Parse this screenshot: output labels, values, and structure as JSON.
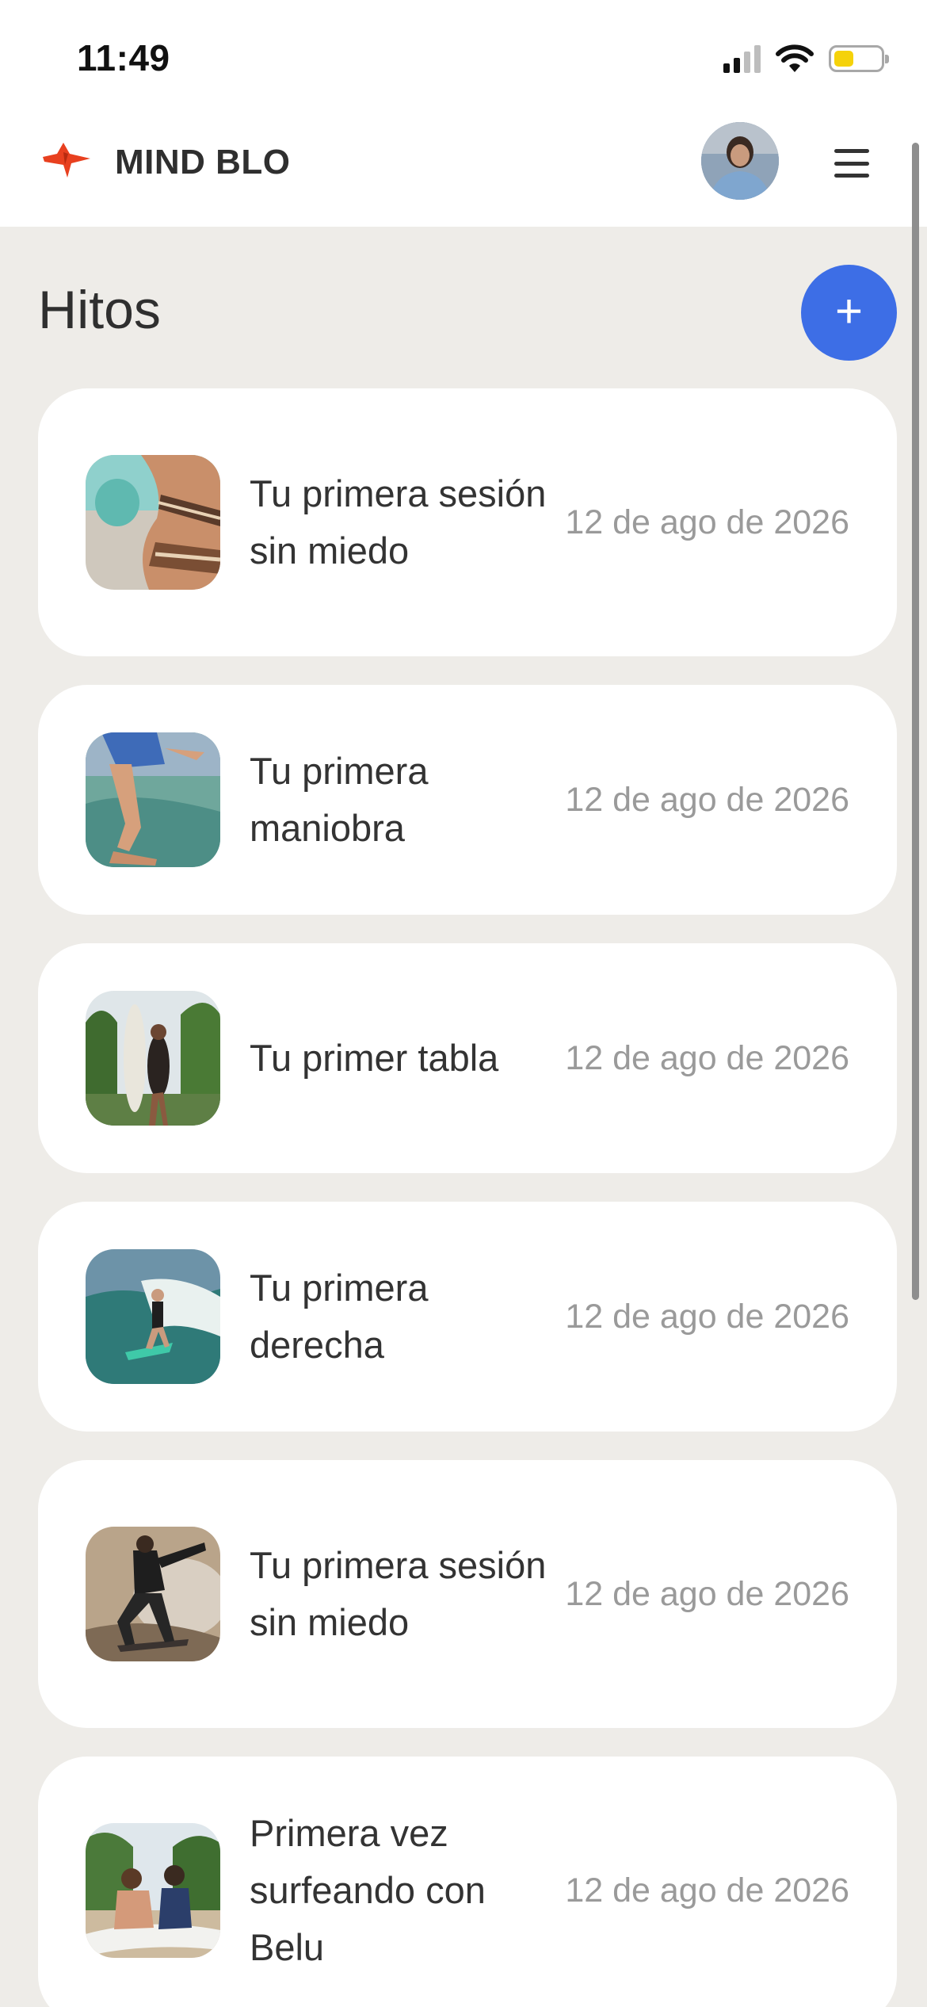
{
  "status_bar": {
    "time": "11:49",
    "battery_color": "#f5d20a",
    "icons": [
      "cellular-signal-icon",
      "wifi-icon",
      "battery-icon"
    ]
  },
  "app_bar": {
    "brand": "MIND BLO",
    "logo_icon": "manta-ray-logo-icon",
    "logo_color": "#e8401f",
    "menu_icon": "hamburger-menu-icon"
  },
  "page": {
    "title": "Hitos",
    "add_button_label": "+",
    "accent_color": "#3d6ee6"
  },
  "milestones": [
    {
      "title": "Tu primera sesión sin miedo",
      "date": "12 de ago de 2026"
    },
    {
      "title": "Tu primera maniobra",
      "date": "12 de ago de 2026"
    },
    {
      "title": "Tu primer tabla",
      "date": "12 de ago de 2026"
    },
    {
      "title": "Tu primera derecha",
      "date": "12 de ago de 2026"
    },
    {
      "title": "Tu primera sesión sin miedo",
      "date": "12 de ago de 2026"
    },
    {
      "title": "Primera vez surfeando con Belu",
      "date": "12 de ago de 2026"
    }
  ]
}
